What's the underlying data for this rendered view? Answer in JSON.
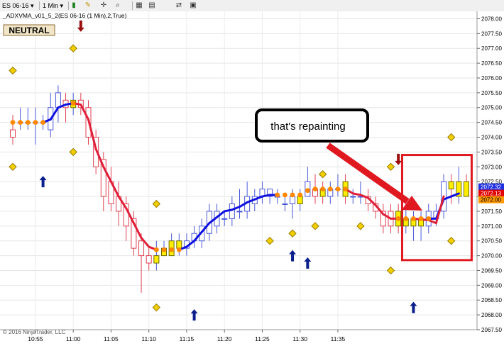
{
  "toolbar": {
    "instrument": "ES 06-16",
    "interval": "1 Min",
    "icons": [
      "bar-type-icon",
      "drawing-pencil-icon",
      "global-crosshair-icon",
      "zoom-icon",
      "properties-icon",
      "data-box-icon",
      "sync-icon",
      "chart-trader-icon"
    ]
  },
  "chart_label": "_ADXVMA_v01_5_2(ES 06-16 (1 Min),2,True)",
  "status_badge": "NEUTRAL",
  "callout": "that's repainting",
  "copyright": "© 2016 NinjaTrader, LLC",
  "colors": {
    "up_trend": "#1010e0",
    "down_trend": "#e0203a",
    "neutral": "#ff8800",
    "up_candle": "#4a58d8",
    "down_candle": "#e04050",
    "highlight_box": "#e01820",
    "arrow_up": "#0a1e8c",
    "arrow_down": "#9a1010",
    "diamond": "#f0d000",
    "price_blue": "#2030e0",
    "price_red": "#e00000",
    "price_orange": "#ff9900"
  },
  "chart_data": {
    "type": "candlestick",
    "time_start": "10:52",
    "x_tick_labels": [
      "10:55",
      "11:00",
      "11:05",
      "11:10",
      "11:15",
      "11:20",
      "11:25",
      "11:30",
      "11:35"
    ],
    "y_range": [
      2067.5,
      2078.25
    ],
    "y_tick_labels": [
      "2067.50",
      "2068.00",
      "2068.50",
      "2069.00",
      "2069.50",
      "2070.00",
      "2070.50",
      "2071.00",
      "2071.50",
      "2072.00",
      "2072.50",
      "2073.00",
      "2073.50",
      "2074.00",
      "2074.50",
      "2075.00",
      "2075.50",
      "2076.00",
      "2076.50",
      "2077.00",
      "2077.50",
      "2078.00"
    ],
    "price_labels": [
      {
        "value": 2072.32,
        "text": "2072.32",
        "role": "blue"
      },
      {
        "value": 2072.13,
        "text": "2072.13",
        "role": "red"
      },
      {
        "value": 2072.0,
        "text": "2072.00",
        "role": "orange"
      }
    ],
    "candles": [
      {
        "o": 2074.25,
        "h": 2074.75,
        "l": 2073.75,
        "c": 2074.0
      },
      {
        "o": 2074.5,
        "h": 2075.0,
        "l": 2074.25,
        "c": 2074.5
      },
      {
        "o": 2074.5,
        "h": 2075.0,
        "l": 2074.25,
        "c": 2074.5
      },
      {
        "o": 2074.5,
        "h": 2075.0,
        "l": 2073.75,
        "c": 2074.5
      },
      {
        "o": 2074.5,
        "h": 2074.75,
        "l": 2074.25,
        "c": 2074.5
      },
      {
        "o": 2074.25,
        "h": 2075.5,
        "l": 2074.0,
        "c": 2075.0
      },
      {
        "o": 2075.0,
        "h": 2075.75,
        "l": 2074.5,
        "c": 2075.5
      },
      {
        "o": 2075.25,
        "h": 2075.5,
        "l": 2074.5,
        "c": 2075.0
      },
      {
        "o": 2075.0,
        "h": 2075.5,
        "l": 2074.75,
        "c": 2075.25
      },
      {
        "o": 2075.25,
        "h": 2075.5,
        "l": 2074.75,
        "c": 2075.0
      },
      {
        "o": 2075.0,
        "h": 2075.25,
        "l": 2073.75,
        "c": 2074.0
      },
      {
        "o": 2074.0,
        "h": 2074.25,
        "l": 2072.75,
        "c": 2073.0
      },
      {
        "o": 2073.25,
        "h": 2073.5,
        "l": 2071.5,
        "c": 2072.0
      },
      {
        "o": 2072.5,
        "h": 2073.0,
        "l": 2071.5,
        "c": 2071.75
      },
      {
        "o": 2072.0,
        "h": 2072.5,
        "l": 2071.0,
        "c": 2071.5
      },
      {
        "o": 2071.75,
        "h": 2072.0,
        "l": 2070.5,
        "c": 2071.0
      },
      {
        "o": 2071.25,
        "h": 2071.5,
        "l": 2070.0,
        "c": 2070.25
      },
      {
        "o": 2070.5,
        "h": 2070.75,
        "l": 2068.75,
        "c": 2070.0
      },
      {
        "o": 2070.0,
        "h": 2070.25,
        "l": 2069.5,
        "c": 2069.75
      },
      {
        "o": 2069.75,
        "h": 2070.5,
        "l": 2069.5,
        "c": 2070.0
      },
      {
        "o": 2070.0,
        "h": 2070.5,
        "l": 2070.0,
        "c": 2070.25
      },
      {
        "o": 2070.0,
        "h": 2070.75,
        "l": 2070.0,
        "c": 2070.5
      },
      {
        "o": 2070.25,
        "h": 2070.75,
        "l": 2070.0,
        "c": 2070.5
      },
      {
        "o": 2070.25,
        "h": 2070.75,
        "l": 2070.0,
        "c": 2070.5
      },
      {
        "o": 2070.5,
        "h": 2071.0,
        "l": 2070.25,
        "c": 2070.75
      },
      {
        "o": 2070.5,
        "h": 2071.25,
        "l": 2070.25,
        "c": 2071.0
      },
      {
        "o": 2070.75,
        "h": 2071.75,
        "l": 2070.5,
        "c": 2071.5
      },
      {
        "o": 2071.0,
        "h": 2071.75,
        "l": 2070.75,
        "c": 2071.5
      },
      {
        "o": 2071.25,
        "h": 2071.5,
        "l": 2071.0,
        "c": 2071.25
      },
      {
        "o": 2071.25,
        "h": 2072.0,
        "l": 2071.0,
        "c": 2071.75
      },
      {
        "o": 2071.5,
        "h": 2072.25,
        "l": 2071.25,
        "c": 2071.5
      },
      {
        "o": 2071.5,
        "h": 2072.5,
        "l": 2071.25,
        "c": 2072.0
      },
      {
        "o": 2071.75,
        "h": 2072.25,
        "l": 2071.5,
        "c": 2072.0
      },
      {
        "o": 2072.0,
        "h": 2072.5,
        "l": 2071.75,
        "c": 2072.25
      },
      {
        "o": 2072.0,
        "h": 2072.25,
        "l": 2071.75,
        "c": 2072.25
      },
      {
        "o": 2072.0,
        "h": 2072.25,
        "l": 2071.75,
        "c": 2072.0
      },
      {
        "o": 2071.75,
        "h": 2072.0,
        "l": 2071.5,
        "c": 2071.75
      },
      {
        "o": 2071.75,
        "h": 2072.25,
        "l": 2071.25,
        "c": 2072.0
      },
      {
        "o": 2071.75,
        "h": 2072.25,
        "l": 2071.5,
        "c": 2072.0
      },
      {
        "o": 2072.0,
        "h": 2073.0,
        "l": 2072.0,
        "c": 2072.5
      },
      {
        "o": 2072.25,
        "h": 2072.75,
        "l": 2071.75,
        "c": 2072.0
      },
      {
        "o": 2072.25,
        "h": 2072.5,
        "l": 2071.75,
        "c": 2072.0
      },
      {
        "o": 2072.0,
        "h": 2072.5,
        "l": 2071.75,
        "c": 2072.25
      },
      {
        "o": 2072.25,
        "h": 2072.75,
        "l": 2072.0,
        "c": 2072.25
      },
      {
        "o": 2072.5,
        "h": 2072.75,
        "l": 2071.75,
        "c": 2072.0
      },
      {
        "o": 2072.0,
        "h": 2072.25,
        "l": 2071.75,
        "c": 2072.0
      },
      {
        "o": 2072.0,
        "h": 2072.5,
        "l": 2071.75,
        "c": 2072.0
      },
      {
        "o": 2072.0,
        "h": 2072.25,
        "l": 2071.5,
        "c": 2071.75
      },
      {
        "o": 2071.75,
        "h": 2072.0,
        "l": 2071.25,
        "c": 2071.5
      },
      {
        "o": 2071.5,
        "h": 2071.75,
        "l": 2070.75,
        "c": 2071.0
      },
      {
        "o": 2071.5,
        "h": 2071.75,
        "l": 2070.75,
        "c": 2071.0
      },
      {
        "o": 2071.5,
        "h": 2071.75,
        "l": 2070.75,
        "c": 2071.0
      },
      {
        "o": 2071.0,
        "h": 2071.75,
        "l": 2070.75,
        "c": 2071.25
      },
      {
        "o": 2071.0,
        "h": 2071.5,
        "l": 2070.5,
        "c": 2071.25
      },
      {
        "o": 2071.0,
        "h": 2071.5,
        "l": 2070.5,
        "c": 2071.25
      },
      {
        "o": 2071.0,
        "h": 2071.75,
        "l": 2070.75,
        "c": 2071.5
      },
      {
        "o": 2071.25,
        "h": 2071.75,
        "l": 2071.0,
        "c": 2071.5
      },
      {
        "o": 2071.5,
        "h": 2072.75,
        "l": 2071.25,
        "c": 2072.5
      },
      {
        "o": 2072.5,
        "h": 2072.75,
        "l": 2071.75,
        "c": 2072.25
      },
      {
        "o": 2072.0,
        "h": 2073.0,
        "l": 2071.75,
        "c": 2072.5
      },
      {
        "o": 2072.5,
        "h": 2072.75,
        "l": 2072.0,
        "c": 2072.0
      }
    ],
    "yellow_bars": [
      8,
      19,
      20,
      21,
      22,
      38,
      41,
      44,
      51,
      52,
      53,
      54,
      58,
      59,
      60
    ],
    "adxvma": [
      {
        "i": 0,
        "v": 2074.5,
        "trend": "neutral"
      },
      {
        "i": 1,
        "v": 2074.5,
        "trend": "neutral"
      },
      {
        "i": 2,
        "v": 2074.5,
        "trend": "neutral"
      },
      {
        "i": 3,
        "v": 2074.5,
        "trend": "neutral"
      },
      {
        "i": 4,
        "v": 2074.5,
        "trend": "neutral"
      },
      {
        "i": 5,
        "v": 2074.6,
        "trend": "up"
      },
      {
        "i": 6,
        "v": 2075.0,
        "trend": "up"
      },
      {
        "i": 7,
        "v": 2075.1,
        "trend": "up"
      },
      {
        "i": 8,
        "v": 2075.15,
        "trend": "neutral"
      },
      {
        "i": 9,
        "v": 2075.1,
        "trend": "down"
      },
      {
        "i": 10,
        "v": 2074.6,
        "trend": "down"
      },
      {
        "i": 11,
        "v": 2073.6,
        "trend": "down"
      },
      {
        "i": 12,
        "v": 2073.0,
        "trend": "down"
      },
      {
        "i": 13,
        "v": 2072.5,
        "trend": "down"
      },
      {
        "i": 14,
        "v": 2072.0,
        "trend": "down"
      },
      {
        "i": 15,
        "v": 2071.6,
        "trend": "down"
      },
      {
        "i": 16,
        "v": 2071.1,
        "trend": "down"
      },
      {
        "i": 17,
        "v": 2070.6,
        "trend": "down"
      },
      {
        "i": 18,
        "v": 2070.3,
        "trend": "down"
      },
      {
        "i": 19,
        "v": 2070.2,
        "trend": "neutral"
      },
      {
        "i": 20,
        "v": 2070.2,
        "trend": "neutral"
      },
      {
        "i": 21,
        "v": 2070.2,
        "trend": "neutral"
      },
      {
        "i": 22,
        "v": 2070.2,
        "trend": "neutral"
      },
      {
        "i": 23,
        "v": 2070.3,
        "trend": "up"
      },
      {
        "i": 24,
        "v": 2070.5,
        "trend": "up"
      },
      {
        "i": 25,
        "v": 2070.8,
        "trend": "up"
      },
      {
        "i": 26,
        "v": 2071.1,
        "trend": "up"
      },
      {
        "i": 27,
        "v": 2071.3,
        "trend": "up"
      },
      {
        "i": 28,
        "v": 2071.5,
        "trend": "up"
      },
      {
        "i": 29,
        "v": 2071.55,
        "trend": "up"
      },
      {
        "i": 30,
        "v": 2071.65,
        "trend": "up"
      },
      {
        "i": 31,
        "v": 2071.8,
        "trend": "up"
      },
      {
        "i": 32,
        "v": 2071.9,
        "trend": "up"
      },
      {
        "i": 33,
        "v": 2072.0,
        "trend": "up"
      },
      {
        "i": 34,
        "v": 2072.05,
        "trend": "up"
      },
      {
        "i": 35,
        "v": 2072.05,
        "trend": "neutral"
      },
      {
        "i": 36,
        "v": 2072.05,
        "trend": "neutral"
      },
      {
        "i": 37,
        "v": 2072.05,
        "trend": "neutral"
      },
      {
        "i": 38,
        "v": 2072.05,
        "trend": "neutral"
      },
      {
        "i": 39,
        "v": 2072.2,
        "trend": "neutral"
      },
      {
        "i": 40,
        "v": 2072.25,
        "trend": "neutral"
      },
      {
        "i": 41,
        "v": 2072.25,
        "trend": "neutral"
      },
      {
        "i": 42,
        "v": 2072.25,
        "trend": "neutral"
      },
      {
        "i": 43,
        "v": 2072.25,
        "trend": "neutral"
      },
      {
        "i": 44,
        "v": 2072.25,
        "trend": "neutral"
      },
      {
        "i": 45,
        "v": 2072.1,
        "trend": "down"
      },
      {
        "i": 46,
        "v": 2072.05,
        "trend": "down"
      },
      {
        "i": 47,
        "v": 2071.95,
        "trend": "down"
      },
      {
        "i": 48,
        "v": 2071.7,
        "trend": "down"
      },
      {
        "i": 49,
        "v": 2071.4,
        "trend": "down"
      },
      {
        "i": 50,
        "v": 2071.25,
        "trend": "down"
      },
      {
        "i": 51,
        "v": 2071.25,
        "trend": "neutral"
      },
      {
        "i": 52,
        "v": 2071.25,
        "trend": "neutral"
      },
      {
        "i": 53,
        "v": 2071.25,
        "trend": "neutral"
      },
      {
        "i": 54,
        "v": 2071.25,
        "trend": "neutral"
      },
      {
        "i": 55,
        "v": 2071.25,
        "trend": "neutral"
      },
      {
        "i": 56,
        "v": 2071.25,
        "trend": "up"
      },
      {
        "i": 57,
        "v": 2071.9,
        "trend": "up"
      },
      {
        "i": 58,
        "v": 2072.0,
        "trend": "up"
      },
      {
        "i": 59,
        "v": 2072.1,
        "trend": "up"
      }
    ],
    "adxvma_repaint": [
      {
        "i": 53,
        "v": 2071.25
      },
      {
        "i": 55,
        "v": 2071.2
      },
      {
        "i": 56,
        "v": 2071.1
      },
      {
        "i": 57,
        "v": 2072.0
      }
    ],
    "diamonds": [
      {
        "i": 0,
        "v": 2076.25
      },
      {
        "i": 0,
        "v": 2073.0
      },
      {
        "i": 8,
        "v": 2077.0
      },
      {
        "i": 8,
        "v": 2073.5
      },
      {
        "i": 19,
        "v": 2071.75
      },
      {
        "i": 19,
        "v": 2068.25
      },
      {
        "i": 34,
        "v": 2070.5
      },
      {
        "i": 37,
        "v": 2070.75
      },
      {
        "i": 40,
        "v": 2071.0
      },
      {
        "i": 41,
        "v": 2072.75
      },
      {
        "i": 46,
        "v": 2071.0
      },
      {
        "i": 50,
        "v": 2069.5
      },
      {
        "i": 50,
        "v": 2073.0
      },
      {
        "i": 58,
        "v": 2074.0
      },
      {
        "i": 58,
        "v": 2070.5
      }
    ],
    "arrows": [
      {
        "i": 4,
        "v": 2072.5,
        "dir": "up"
      },
      {
        "i": 9,
        "v": 2077.75,
        "dir": "down"
      },
      {
        "i": 24,
        "v": 2068.0,
        "dir": "up"
      },
      {
        "i": 37,
        "v": 2070.0,
        "dir": "up"
      },
      {
        "i": 39,
        "v": 2069.75,
        "dir": "up"
      },
      {
        "i": 51,
        "v": 2073.25,
        "dir": "down"
      },
      {
        "i": 53,
        "v": 2068.25,
        "dir": "up"
      }
    ]
  }
}
